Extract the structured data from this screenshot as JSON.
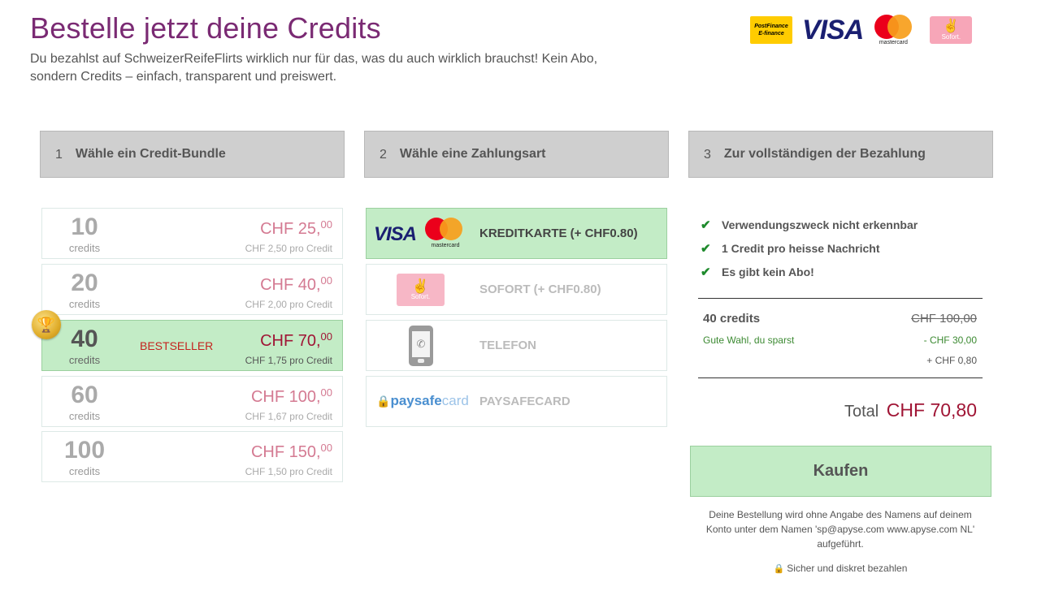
{
  "header": {
    "title": "Bestelle jetzt deine Credits",
    "subtitle": "Du bezahlst auf SchweizerReifeFlirts wirklich nur für das, was du auch wirklich brauchst! Kein Abo, sondern Credits – einfach, transparent und preiswert."
  },
  "logos": {
    "postfinance_line1": "PostFinance",
    "postfinance_line2": "E-finance",
    "visa": "VISA",
    "mastercard": "mastercard",
    "sofort": "Sofort."
  },
  "steps": [
    {
      "num": "1",
      "label": "Wähle ein Credit-Bundle"
    },
    {
      "num": "2",
      "label": "Wähle eine Zahlungsart"
    },
    {
      "num": "3",
      "label": "Zur vollständigen der Bezahlung"
    }
  ],
  "bundles": [
    {
      "qty": "10",
      "unit": "credits",
      "price": "CHF 25,",
      "cents": "00",
      "per": "CHF 2,50 pro Credit"
    },
    {
      "qty": "20",
      "unit": "credits",
      "price": "CHF 40,",
      "cents": "00",
      "per": "CHF 2,00 pro Credit"
    },
    {
      "qty": "40",
      "unit": "credits",
      "price": "CHF 70,",
      "cents": "00",
      "per": "CHF 1,75 pro Credit",
      "badge": "BESTSELLER",
      "selected": true
    },
    {
      "qty": "60",
      "unit": "credits",
      "price": "CHF 100,",
      "cents": "00",
      "per": "CHF 1,67 pro Credit"
    },
    {
      "qty": "100",
      "unit": "credits",
      "price": "CHF 150,",
      "cents": "00",
      "per": "CHF 1,50 pro Credit"
    }
  ],
  "methods": [
    {
      "label": "KREDITKARTE (+ CHF0.80)",
      "icon": "visa-mastercard-logo",
      "selected": true
    },
    {
      "label": "SOFORT (+ CHF0.80)",
      "icon": "sofort-logo"
    },
    {
      "label": "TELEFON",
      "icon": "phone-icon"
    },
    {
      "label": "PAYSAFECARD",
      "icon": "paysafecard-logo"
    }
  ],
  "method_logos": {
    "visa": "VISA",
    "mastercard": "mastercard",
    "sofort": "Sofort.",
    "paysafe": "paysafe",
    "card": "card"
  },
  "benefits": [
    "Verwendungszweck nicht erkennbar",
    "1 Credit pro heisse Nachricht",
    "Es gibt kein Abo!"
  ],
  "summary": {
    "credits_label": "40 credits",
    "original_price": "CHF 100,00",
    "savings_label": "Gute Wahl, du sparst",
    "savings_value": "- CHF 30,00",
    "fee_value": "+ CHF 0,80",
    "total_label": "Total",
    "total_value": "CHF 70,80"
  },
  "buy_button": "Kaufen",
  "note": "Deine Bestellung wird ohne Angabe des Namens auf deinem Konto unter dem Namen 'sp@apyse.com www.apyse.com NL' aufgeführt.",
  "secure": "Sicher und diskret bezahlen",
  "colors": {
    "title": "#7a2a73",
    "selected_bg": "#c3ecc6",
    "price_selected": "#a01535",
    "price_muted": "#d47a92",
    "check_green": "#1e8a2c"
  }
}
